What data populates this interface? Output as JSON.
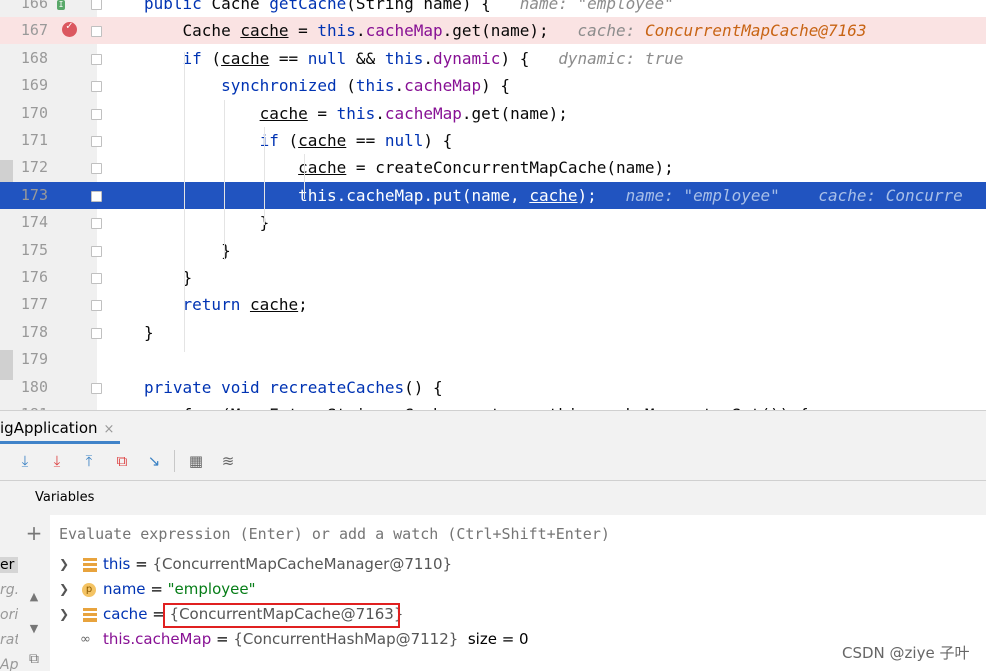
{
  "editor": {
    "lines": [
      {
        "num": "166",
        "parts": [
          {
            "t": "public ",
            "c": "kw"
          },
          {
            "t": "Cache ",
            "c": ""
          },
          {
            "t": "getCache",
            "c": "kw"
          },
          {
            "t": "(String name) {   ",
            "c": ""
          },
          {
            "t": "name: \"employee\"",
            "c": "hint"
          }
        ]
      },
      {
        "num": "167",
        "parts": [
          {
            "t": "    Cache ",
            "c": ""
          },
          {
            "t": "cache",
            "c": "ul"
          },
          {
            "t": " = ",
            "c": ""
          },
          {
            "t": "this",
            "c": "kw"
          },
          {
            "t": ".",
            "c": ""
          },
          {
            "t": "cacheMap",
            "c": "fld"
          },
          {
            "t": ".get(name);   ",
            "c": ""
          },
          {
            "t": "cache: ",
            "c": "hint"
          },
          {
            "t": "ConcurrentMapCache@7163",
            "c": "hint-ov"
          }
        ]
      },
      {
        "num": "168",
        "parts": [
          {
            "t": "    ",
            "c": ""
          },
          {
            "t": "if",
            "c": "kw"
          },
          {
            "t": " (",
            "c": ""
          },
          {
            "t": "cache",
            "c": "ul"
          },
          {
            "t": " == ",
            "c": ""
          },
          {
            "t": "null",
            "c": "kw"
          },
          {
            "t": " && ",
            "c": ""
          },
          {
            "t": "this",
            "c": "kw"
          },
          {
            "t": ".",
            "c": ""
          },
          {
            "t": "dynamic",
            "c": "fld"
          },
          {
            "t": ") {   ",
            "c": ""
          },
          {
            "t": "dynamic: true",
            "c": "hint"
          }
        ]
      },
      {
        "num": "169",
        "parts": [
          {
            "t": "        ",
            "c": ""
          },
          {
            "t": "synchronized",
            "c": "kw"
          },
          {
            "t": " (",
            "c": ""
          },
          {
            "t": "this",
            "c": "kw"
          },
          {
            "t": ".",
            "c": ""
          },
          {
            "t": "cacheMap",
            "c": "fld"
          },
          {
            "t": ") {",
            "c": ""
          }
        ]
      },
      {
        "num": "170",
        "parts": [
          {
            "t": "            ",
            "c": ""
          },
          {
            "t": "cache",
            "c": "ul"
          },
          {
            "t": " = ",
            "c": ""
          },
          {
            "t": "this",
            "c": "kw"
          },
          {
            "t": ".",
            "c": ""
          },
          {
            "t": "cacheMap",
            "c": "fld"
          },
          {
            "t": ".get(name);",
            "c": ""
          }
        ]
      },
      {
        "num": "171",
        "parts": [
          {
            "t": "            ",
            "c": ""
          },
          {
            "t": "if",
            "c": "kw"
          },
          {
            "t": " (",
            "c": ""
          },
          {
            "t": "cache",
            "c": "ul"
          },
          {
            "t": " == ",
            "c": ""
          },
          {
            "t": "null",
            "c": "kw"
          },
          {
            "t": ") {",
            "c": ""
          }
        ]
      },
      {
        "num": "172",
        "parts": [
          {
            "t": "                ",
            "c": ""
          },
          {
            "t": "cache",
            "c": "ul"
          },
          {
            "t": " = createConcurrentMapCache(name);",
            "c": ""
          }
        ]
      },
      {
        "num": "173",
        "parts": [
          {
            "t": "                this.cacheMap.put(name, ",
            "c": ""
          },
          {
            "t": "cache",
            "c": "ul"
          },
          {
            "t": ");   ",
            "c": ""
          },
          {
            "t": "name: \"employee\"    cache: Concurre",
            "c": "hint"
          }
        ]
      },
      {
        "num": "174",
        "parts": [
          {
            "t": "            }",
            "c": ""
          }
        ]
      },
      {
        "num": "175",
        "parts": [
          {
            "t": "        }",
            "c": ""
          }
        ]
      },
      {
        "num": "176",
        "parts": [
          {
            "t": "    }",
            "c": ""
          }
        ]
      },
      {
        "num": "177",
        "parts": [
          {
            "t": "    ",
            "c": ""
          },
          {
            "t": "return",
            "c": "kw"
          },
          {
            "t": " ",
            "c": ""
          },
          {
            "t": "cache",
            "c": "ul"
          },
          {
            "t": ";",
            "c": ""
          }
        ]
      },
      {
        "num": "178",
        "parts": [
          {
            "t": "}",
            "c": ""
          }
        ]
      },
      {
        "num": "179",
        "parts": []
      },
      {
        "num": "180",
        "parts": [
          {
            "t": "private void ",
            "c": "kw"
          },
          {
            "t": "recreateCaches",
            "c": "kw"
          },
          {
            "t": "() {",
            "c": ""
          }
        ]
      },
      {
        "num": "181",
        "parts": [
          {
            "t": "    for (Map.Entry<String, Cache> entry : this.cacheMap.entrySet()) {",
            "c": ""
          }
        ]
      }
    ],
    "breakpoint_line_index": 1,
    "current_line_index": 7
  },
  "run_tab": {
    "label": "igApplication",
    "close": "×"
  },
  "toolbar": {
    "icons": [
      "step-over-icon",
      "step-into-icon",
      "force-step-into-icon",
      "step-out-icon",
      "drop-frame-icon",
      "run-to-cursor-icon",
      "evaluate-icon",
      "trace-icon"
    ]
  },
  "frames_panel": {
    "items": [
      "er",
      "rg.",
      "ori",
      "rat",
      "Ap"
    ]
  },
  "variables": {
    "title": "Variables",
    "eval_placeholder": "Evaluate expression (Enter) or add a watch (Ctrl+Shift+Enter)",
    "rows": [
      {
        "expand": true,
        "icon": "list",
        "name": "this",
        "eq": " = ",
        "value": "{ConcurrentMapCacheManager@7110}",
        "kind": "obj"
      },
      {
        "expand": true,
        "icon": "param",
        "name": "name",
        "eq": " = ",
        "value": "\"employee\"",
        "kind": "str"
      },
      {
        "expand": true,
        "icon": "list",
        "name": "cache",
        "eq": " = ",
        "value": "{ConcurrentMapCache@7163}",
        "kind": "obj"
      },
      {
        "expand": false,
        "icon": "glass",
        "name": "this.cacheMap",
        "eq": " = ",
        "value": "{ConcurrentHashMap@7112}",
        "extra": "  size = 0",
        "kind": "obj"
      }
    ]
  },
  "watermark": "CSDN @ziye 子叶"
}
